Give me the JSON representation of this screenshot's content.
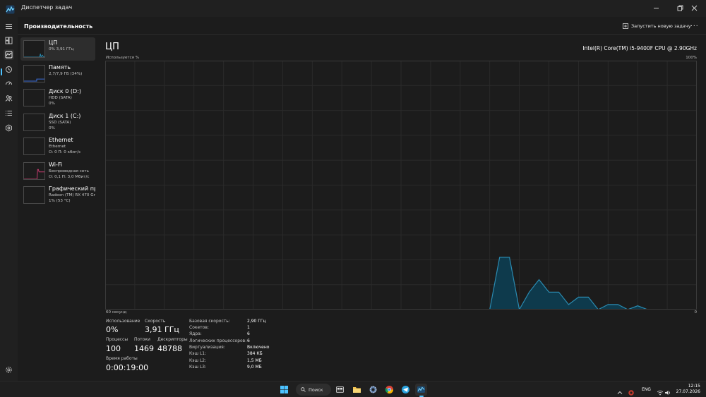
{
  "window": {
    "title": "Диспетчер задач"
  },
  "header": {
    "title": "Производительность",
    "run_task_label": "Запустить новую задачу",
    "more_label": "..."
  },
  "devices": [
    {
      "name": "ЦП",
      "sub": "0% 3,91 ГГц",
      "sub2": "",
      "selected": true
    },
    {
      "name": "Память",
      "sub": "2,7/7,9 ГБ (34%)",
      "sub2": "",
      "selected": false
    },
    {
      "name": "Диск 0 (D:)",
      "sub": "HDD (SATA)",
      "sub2": "0%",
      "selected": false
    },
    {
      "name": "Диск 1 (C:)",
      "sub": "SSD (SATA)",
      "sub2": "0%",
      "selected": false
    },
    {
      "name": "Ethernet",
      "sub": "Ethernet",
      "sub2": "О: 0 П: 0 кбит/с",
      "selected": false
    },
    {
      "name": "Wi-Fi",
      "sub": "Беспроводная сеть",
      "sub2": "О: 0,1 П: 3,0 Мбит/с",
      "selected": false
    },
    {
      "name": "Графический про",
      "sub": "Radeon (TM) RX 470 Gra",
      "sub2": "1% (53 °C)",
      "selected": false
    }
  ],
  "detail": {
    "title": "ЦП",
    "model": "Intel(R) Core(TM) i5-9400F CPU @ 2.90GHz",
    "y_label": "Используется %",
    "y_max_label": "100%",
    "x_left_label": "60 секунд",
    "x_right_label": "0"
  },
  "stats": {
    "usage_label": "Использование",
    "usage_value": "0%",
    "speed_label": "Скорость",
    "speed_value": "3,91 ГГц",
    "processes_label": "Процессы",
    "processes_value": "100",
    "threads_label": "Потоки",
    "threads_value": "1469",
    "handles_label": "Дескрипторы",
    "handles_value": "48788",
    "uptime_label": "Время работы",
    "uptime_value": "0:00:19:00"
  },
  "specs": [
    {
      "key": "Базовая скорость:",
      "value": "2,90 ГГц"
    },
    {
      "key": "Сокетов:",
      "value": "1"
    },
    {
      "key": "Ядра:",
      "value": "6"
    },
    {
      "key": "Логических процессоров:",
      "value": "6"
    },
    {
      "key": "Виртуализация:",
      "value": "Включено"
    },
    {
      "key": "Кэш L1:",
      "value": "384 КБ"
    },
    {
      "key": "Кэш L2:",
      "value": "1,5 МБ"
    },
    {
      "key": "Кэш L3:",
      "value": "9,0 МБ"
    }
  ],
  "chart_data": {
    "type": "area",
    "x": [
      60,
      59,
      58,
      57,
      56,
      55,
      54,
      53,
      52,
      51,
      50,
      49,
      48,
      47,
      46,
      45,
      44,
      43,
      42,
      41,
      40,
      39,
      38,
      37,
      36,
      35,
      34,
      33,
      32,
      31,
      30,
      29,
      28,
      27,
      26,
      25,
      24,
      23,
      22,
      21,
      20,
      19,
      18,
      17,
      16,
      15,
      14,
      13,
      12,
      11,
      10,
      9,
      8,
      7,
      6,
      5,
      4,
      3,
      2,
      1,
      0
    ],
    "values": [
      0,
      0,
      0,
      0,
      0,
      0,
      0,
      0,
      0,
      0,
      0,
      0,
      0,
      0,
      0,
      0,
      0,
      0,
      0,
      0,
      0,
      0,
      0,
      0,
      0,
      0,
      0,
      0,
      0,
      0,
      0,
      0,
      0,
      0,
      0,
      0,
      0,
      0,
      0,
      0,
      21,
      21,
      0,
      7,
      12,
      7,
      7,
      2,
      5,
      5,
      0,
      2,
      2,
      0,
      1.5,
      0,
      0,
      0,
      0,
      0,
      0
    ],
    "ylim": [
      0,
      100
    ],
    "xlim": [
      60,
      0
    ],
    "grid": true,
    "colors": {
      "line": "#2a8ab0",
      "fill": "#0e3a4c",
      "grid": "#2a2a2a",
      "frame": "#3a3a3a"
    }
  },
  "thumbs": {
    "cpu": {
      "color": "#2a8ab0",
      "values": [
        0,
        0,
        0,
        0,
        0,
        0,
        0,
        0,
        0,
        0,
        0,
        0,
        0,
        0,
        0,
        0,
        0,
        0,
        0,
        0,
        0,
        0,
        0,
        0,
        21,
        0,
        7,
        12,
        5,
        2,
        0
      ]
    },
    "memory": {
      "color": "#3a6cd8",
      "level": 34
    },
    "wifi": {
      "color": "#c23b6d",
      "values": [
        0,
        0,
        0,
        0,
        0,
        0,
        0,
        0,
        0,
        0,
        0,
        0,
        0,
        0,
        0,
        0,
        0,
        0,
        0,
        0,
        60,
        60,
        45,
        45,
        45,
        45,
        45,
        45,
        45,
        45,
        45
      ]
    }
  },
  "taskbar": {
    "search_label": "Поиск",
    "lang": "ENG",
    "time": "12:15",
    "date": "27.07.2026"
  },
  "accent": "#4cc2ff"
}
